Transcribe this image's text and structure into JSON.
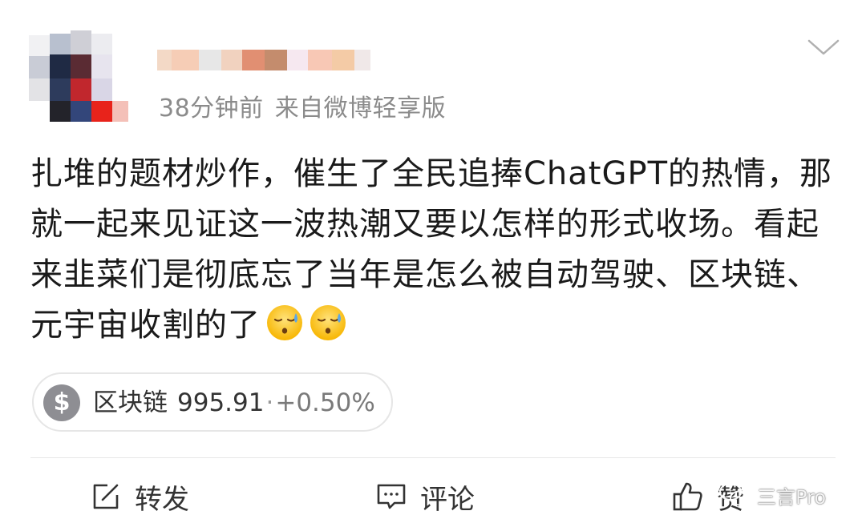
{
  "post": {
    "meta_time": "38分钟前",
    "meta_source": "来自微博轻享版",
    "body_text": "扎堆的题材炒作，催生了全民追捧ChatGPT的热情，那就一起来见证这一波热潮又要以怎样的形式收场。看起来韭菜们是彻底忘了当年是怎么被自动驾驶、区块链、元宇宙收割的了",
    "emoji_icons": [
      "sweat-face-icon",
      "sweat-face-icon"
    ]
  },
  "stock_chip": {
    "icon": "dollar-coin-icon",
    "name": "区块链",
    "price": "995.91",
    "separator": "·",
    "change": "+0.50%"
  },
  "actions": {
    "repost_label": "转发",
    "comment_label": "评论",
    "like_label": "赞"
  },
  "watermark": {
    "text": "三言Pro"
  },
  "colors": {
    "meta_gray": "#8b8b8b",
    "text_dark": "#1a1a1a",
    "divider": "#e8e8e8",
    "coin_gray": "#8e8e93"
  }
}
